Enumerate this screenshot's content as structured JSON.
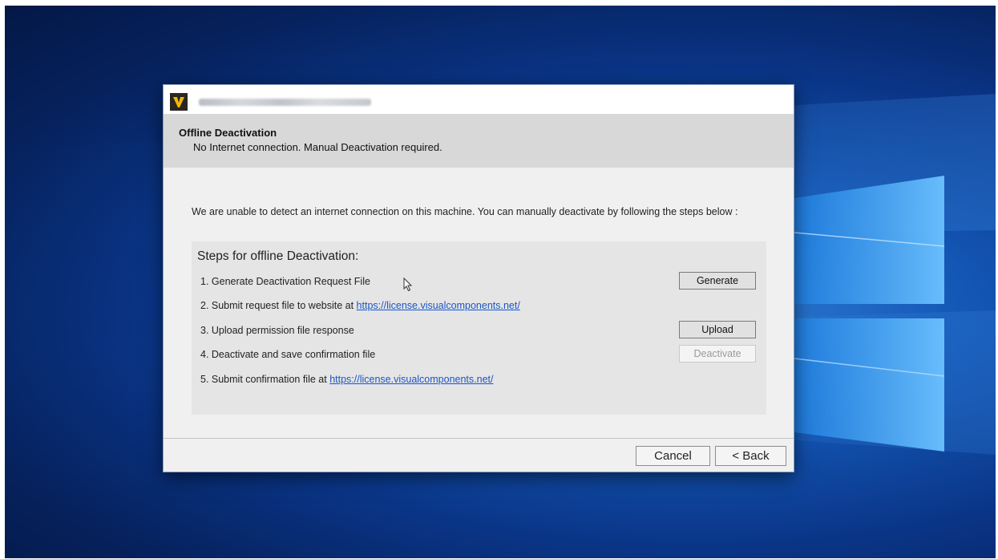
{
  "dialog": {
    "header_title": "Offline Deactivation",
    "header_subtitle": "No Internet connection. Manual Deactivation required.",
    "intro_text": "We are unable to detect an internet connection on this machine. You can manually deactivate by following the steps below :",
    "steps_title": "Steps for offline Deactivation:",
    "steps": [
      {
        "text": "1. Generate Deactivation Request File",
        "link": ""
      },
      {
        "text": "2. Submit request file to website at ",
        "link": "https://license.visualcomponents.net/"
      },
      {
        "text": "3. Upload permission file response",
        "link": ""
      },
      {
        "text": "4. Deactivate and save confirmation file",
        "link": ""
      },
      {
        "text": "5. Submit confirmation file at ",
        "link": "https://license.visualcomponents.net/"
      }
    ],
    "buttons": {
      "generate": "Generate",
      "upload": "Upload",
      "deactivate": "Deactivate",
      "cancel": "Cancel",
      "back": "< Back"
    }
  },
  "icons": {
    "app_icon": "visual-components-v-logo",
    "cursor": "mouse-pointer-icon",
    "background_logo": "windows-logo"
  },
  "colors": {
    "link": "#1a56c8",
    "desktop_accent": "#1356b4",
    "app_icon_bg": "#2b2622",
    "app_icon_fg": "#f2b705"
  }
}
